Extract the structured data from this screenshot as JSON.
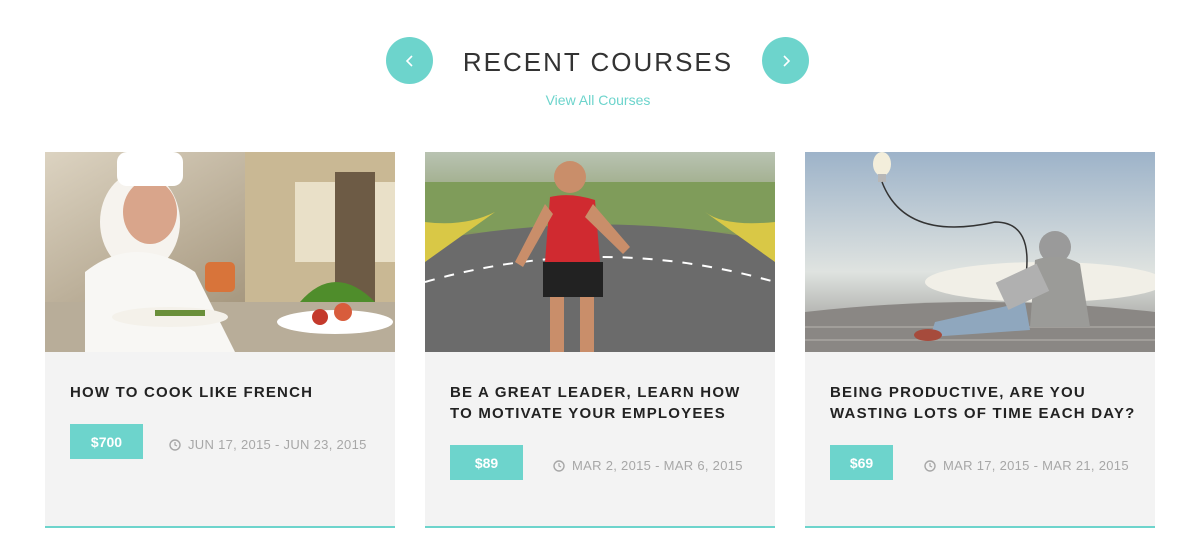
{
  "header": {
    "title": "RECENT COURSES",
    "view_all_label": "View All Courses",
    "prev_icon": "chevron-left-icon",
    "next_icon": "chevron-right-icon"
  },
  "courses": [
    {
      "title": "HOW TO COOK LIKE FRENCH",
      "price": "$700",
      "dates": "JUN 17, 2015 - JUN 23, 2015",
      "image": "chef-plating-food-photo"
    },
    {
      "title": "BE A GREAT LEADER, LEARN HOW TO MOTIVATE YOUR EMPLOYEES",
      "price": "$89",
      "dates": "MAR 2, 2015 - MAR 6, 2015",
      "image": "man-running-on-road-photo"
    },
    {
      "title": "BEING PRODUCTIVE, ARE YOU WASTING LOTS OF TIME EACH DAY?",
      "price": "$69",
      "dates": "MAR 17, 2015 - MAR 21, 2015",
      "image": "man-with-laptop-and-lightbulb-photo"
    }
  ],
  "colors": {
    "accent": "#6dd4cc",
    "card_bg": "#f3f3f3",
    "title_text": "#222222",
    "meta_text": "#a7a7a7"
  }
}
